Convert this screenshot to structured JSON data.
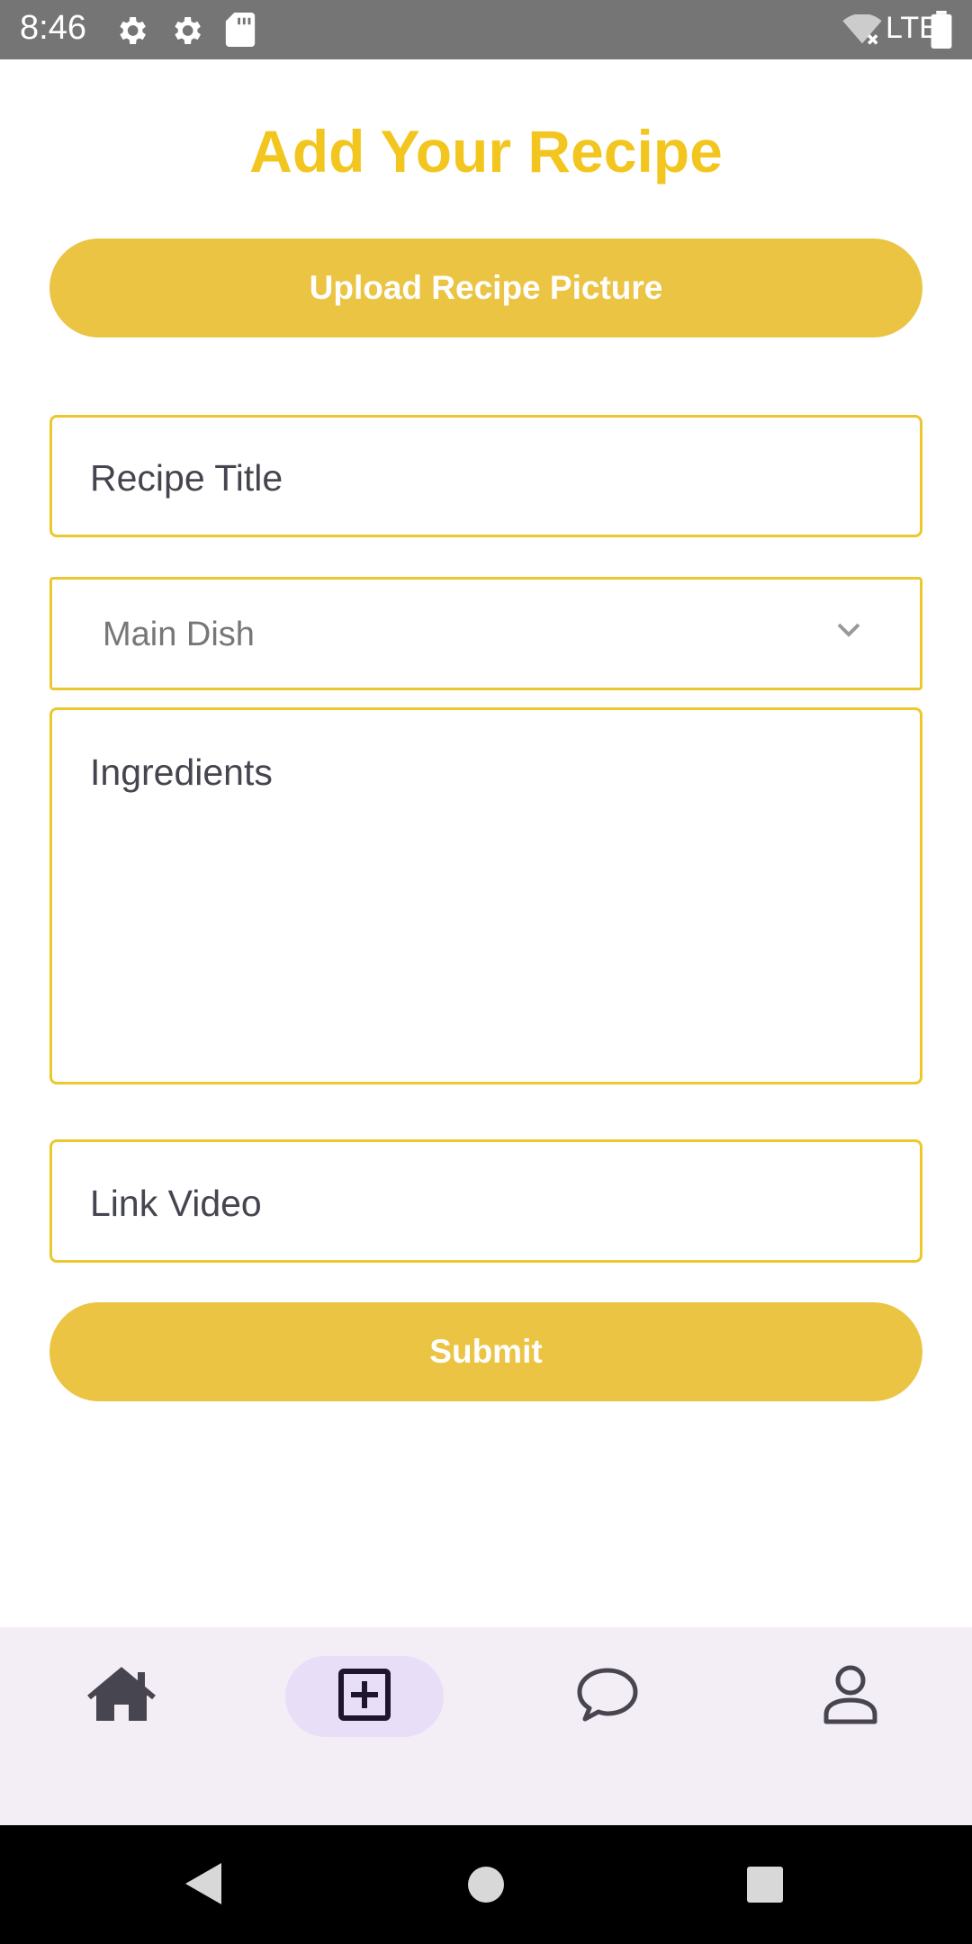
{
  "status_bar": {
    "time": "8:46",
    "network": "LTE",
    "icons": [
      "settings-icon",
      "settings-icon",
      "sd-card-icon",
      "wifi-off-icon",
      "battery-icon"
    ]
  },
  "header": {
    "title": "Add Your Recipe"
  },
  "form": {
    "upload_label": "Upload Recipe Picture",
    "title_placeholder": "Recipe Title",
    "category_selected": "Main Dish",
    "ingredients_placeholder": "Ingredients",
    "video_placeholder": "Link Video",
    "submit_label": "Submit"
  },
  "bottom_nav": {
    "items": [
      {
        "icon": "home-icon",
        "active": false
      },
      {
        "icon": "add-box-icon",
        "active": true
      },
      {
        "icon": "chat-icon",
        "active": false
      },
      {
        "icon": "person-icon",
        "active": false
      }
    ]
  },
  "colors": {
    "accent": "#ecc443",
    "title": "#f2c61f",
    "field_border": "#ecc82f",
    "nav_background": "#f3edf6",
    "nav_active": "#e8def8"
  }
}
